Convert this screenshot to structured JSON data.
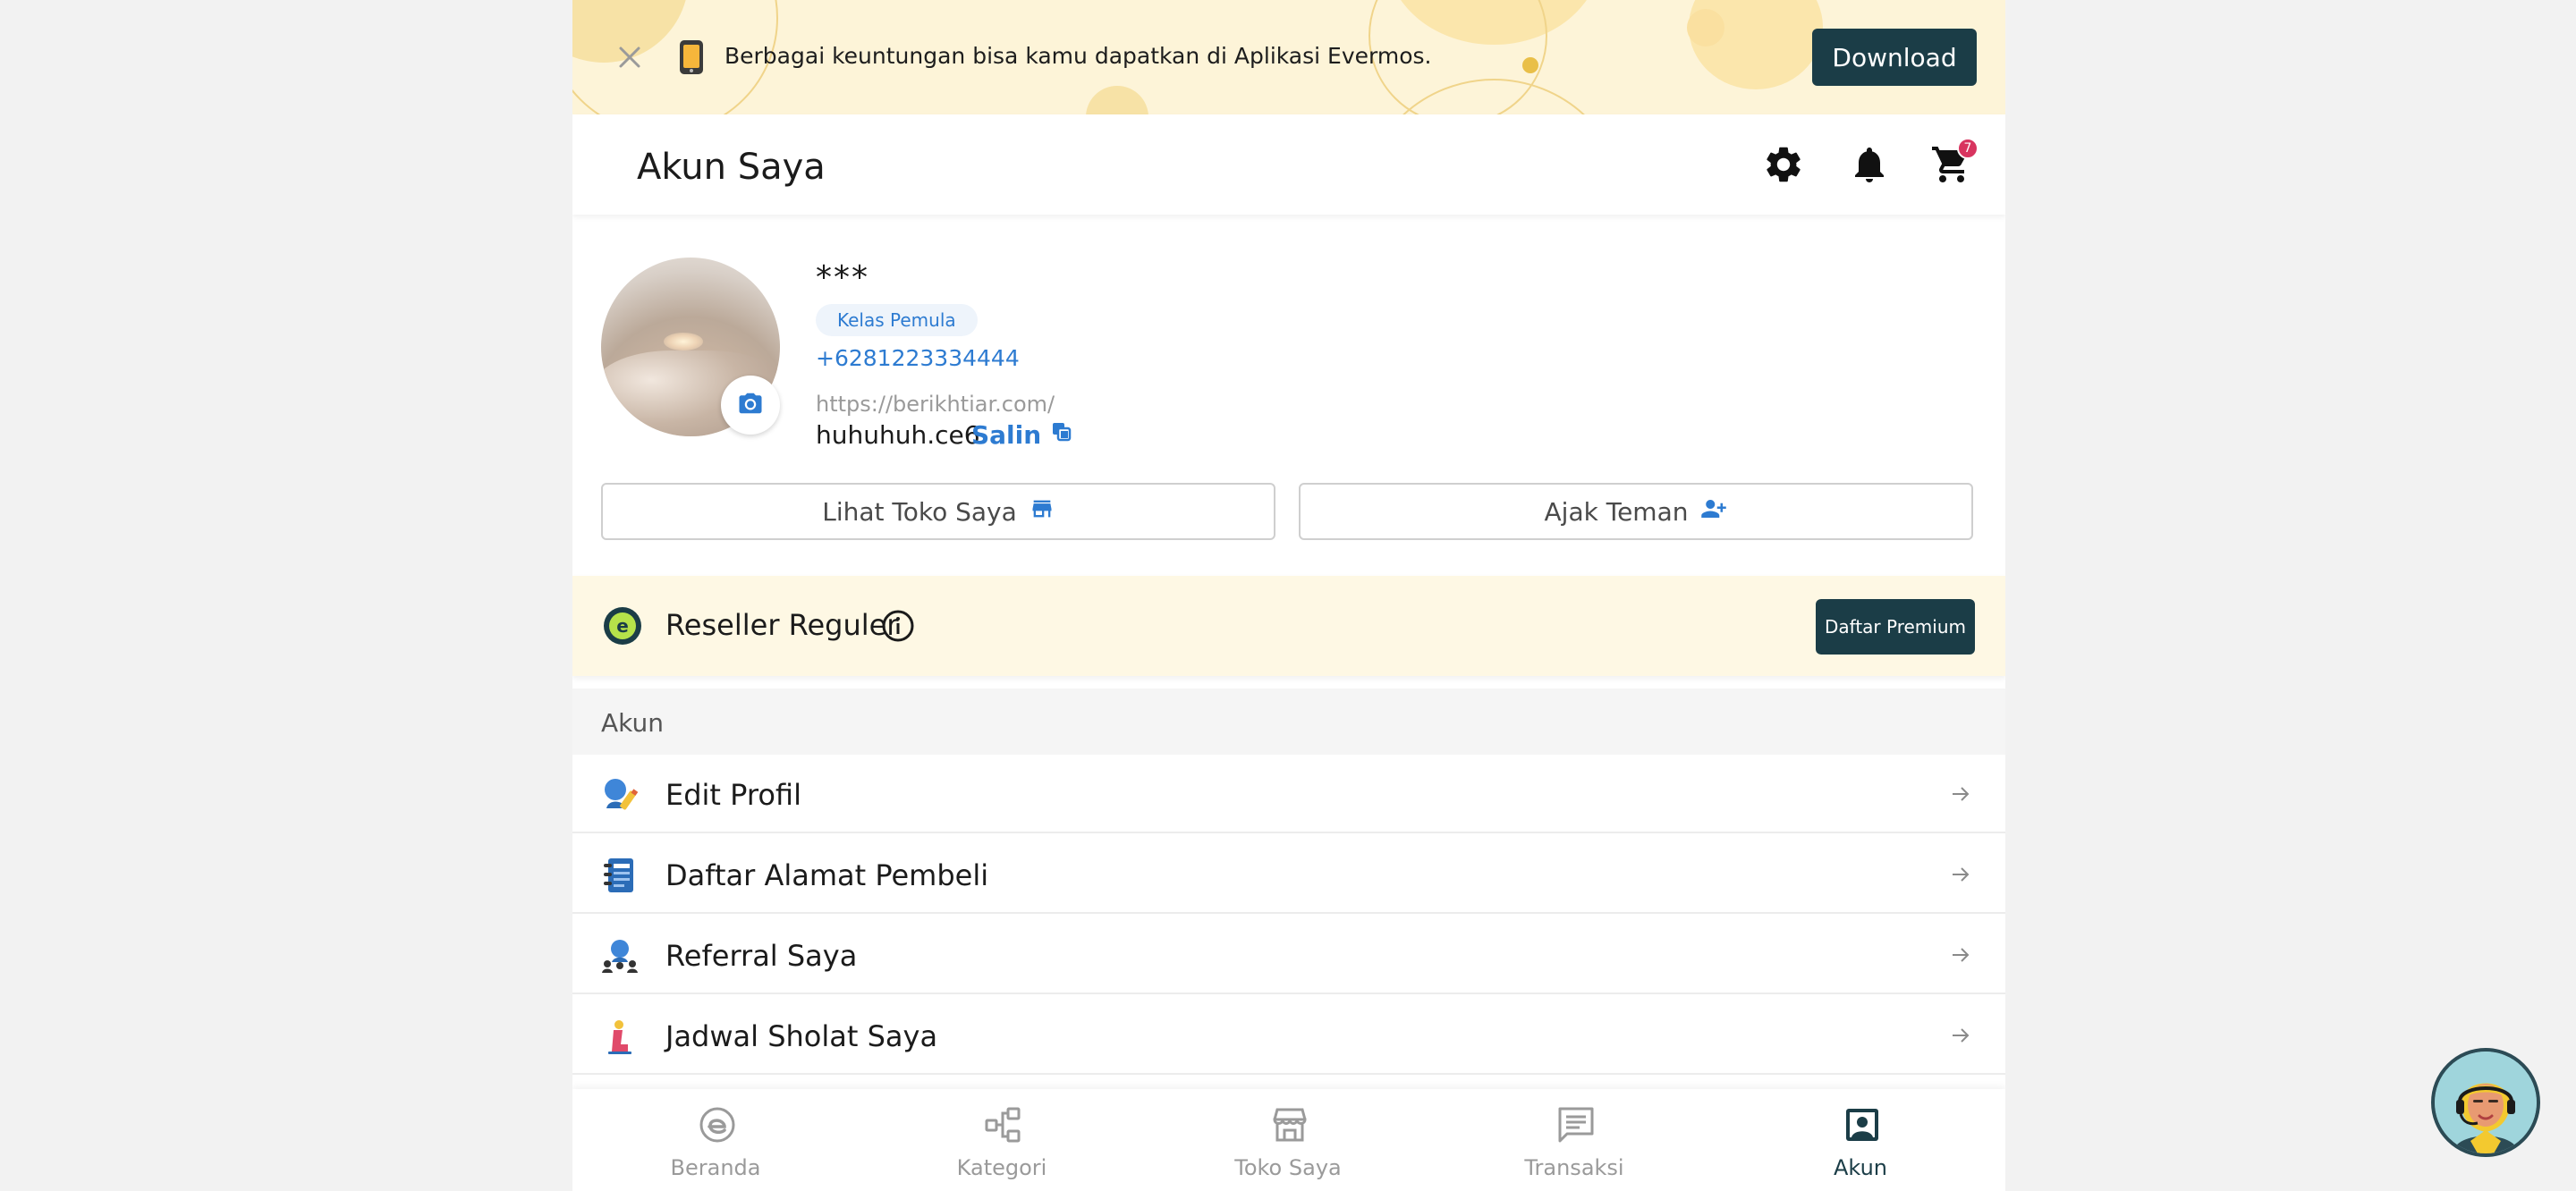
{
  "banner": {
    "text": "Berbagai keuntungan bisa kamu dapatkan di Aplikasi Evermos.",
    "download_label": "Download"
  },
  "header": {
    "title": "Akun Saya",
    "cart_count": "7"
  },
  "profile": {
    "name": "***",
    "level": "Kelas Pemula",
    "phone": "+6281223334444",
    "shop_url": "https://berikhtiar.com/",
    "shop_slug": "huhuhuh.ce6",
    "copy_label": "Salin"
  },
  "actions": {
    "view_shop": "Lihat Toko Saya",
    "invite_friend": "Ajak Teman"
  },
  "reseller": {
    "title": "Reseller Reguler",
    "premium_label": "Daftar Premium"
  },
  "account_section": {
    "title": "Akun",
    "items": [
      {
        "label": "Edit Profil",
        "icon": "edit-profile-icon"
      },
      {
        "label": "Daftar Alamat Pembeli",
        "icon": "address-book-icon"
      },
      {
        "label": "Referral Saya",
        "icon": "referral-icon"
      },
      {
        "label": "Jadwal Sholat Saya",
        "icon": "prayer-icon"
      }
    ]
  },
  "bottom_nav": [
    {
      "label": "Beranda",
      "icon": "home-icon"
    },
    {
      "label": "Kategori",
      "icon": "category-icon"
    },
    {
      "label": "Toko Saya",
      "icon": "store-icon"
    },
    {
      "label": "Transaksi",
      "icon": "transaction-icon"
    },
    {
      "label": "Akun",
      "icon": "account-icon",
      "active": true
    }
  ],
  "colors": {
    "primary_dark": "#1b3d47",
    "link_blue": "#2d7bd1",
    "banner_bg": "#fdf4d8",
    "reseller_bg": "#fef8e4",
    "badge_red": "#d8345f"
  }
}
